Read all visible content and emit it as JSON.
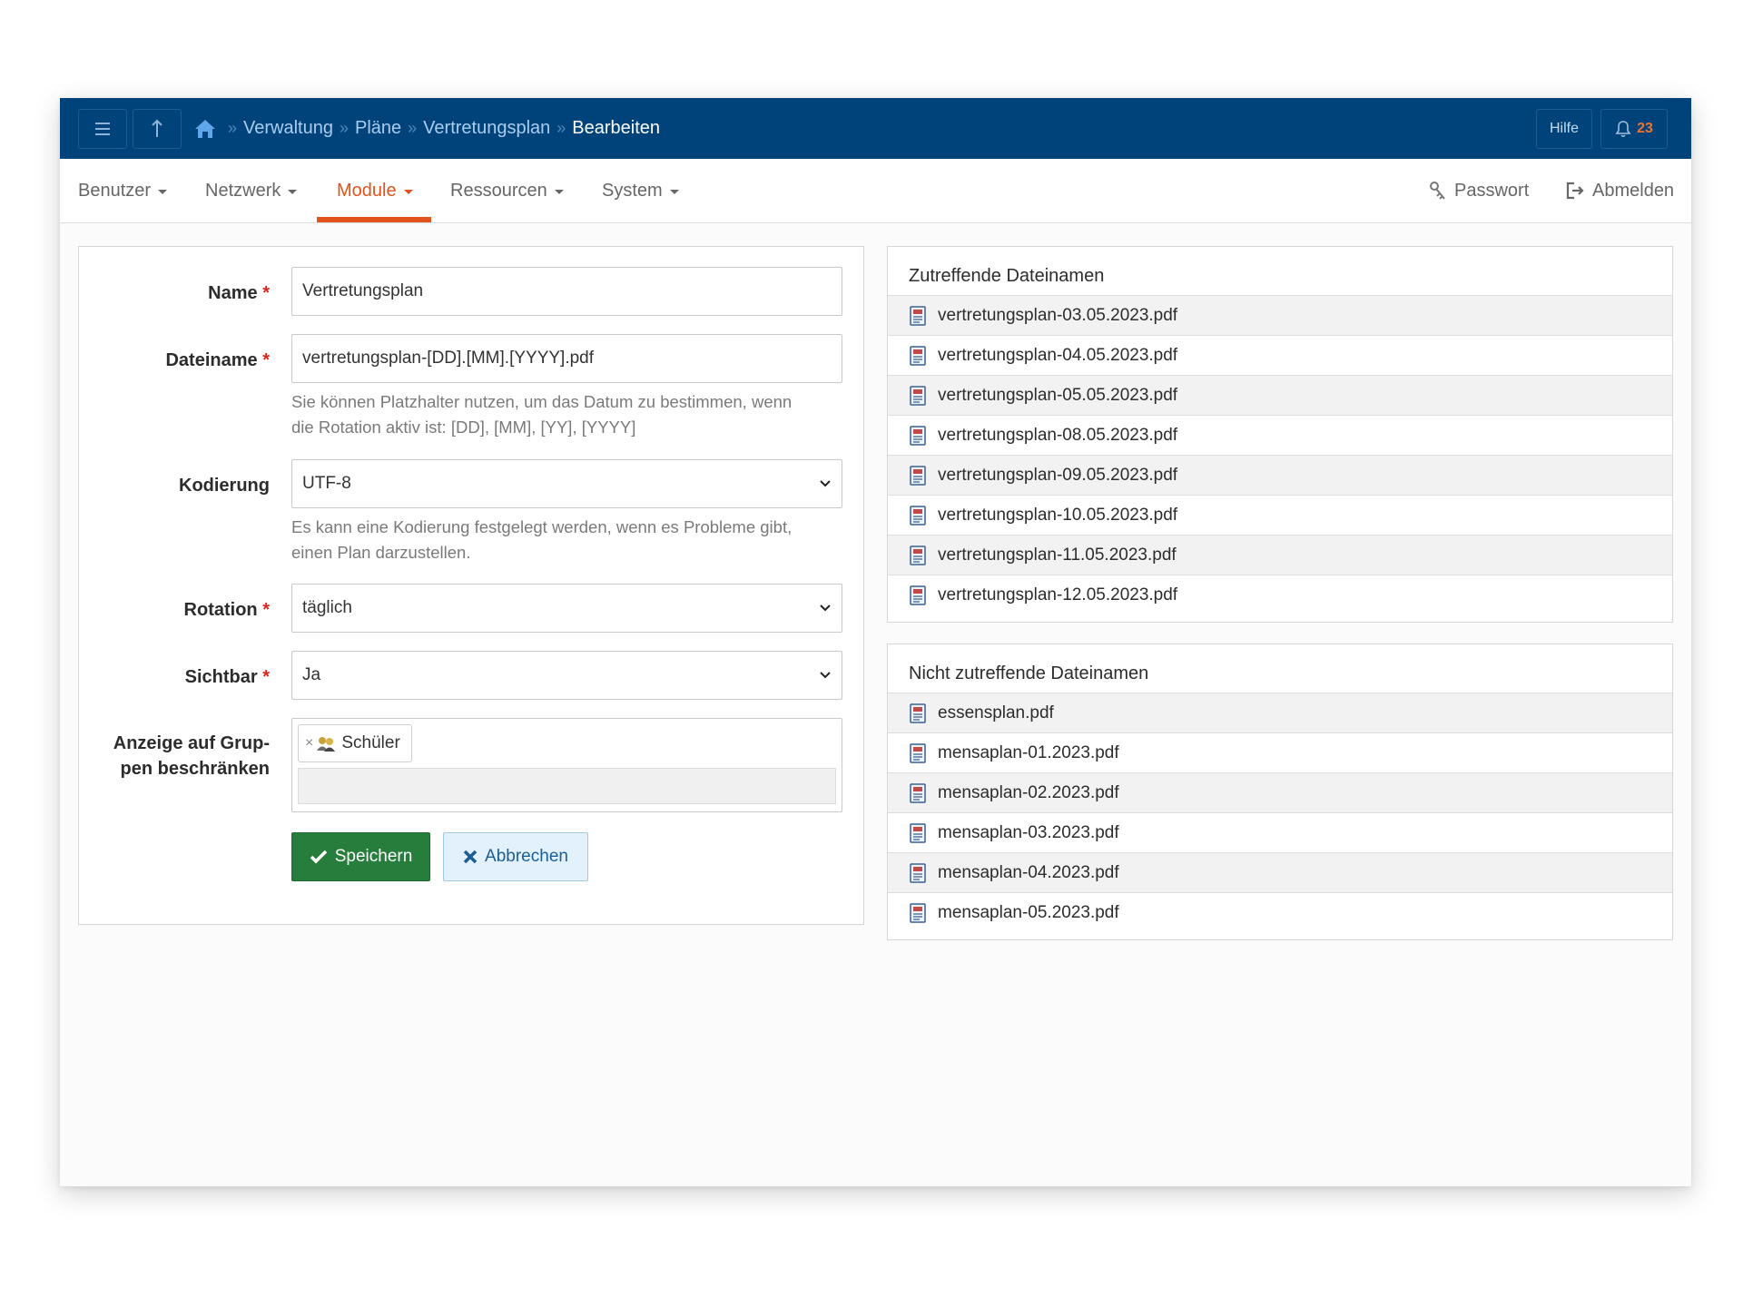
{
  "topbar": {
    "menu_icon": "hamburger-icon",
    "up_icon": "arrow-up-icon",
    "breadcrumb": {
      "home_icon": "home-icon",
      "separator": "»",
      "items": [
        "Verwaltung",
        "Pläne",
        "Vertretungsplan"
      ],
      "current": "Bearbeiten"
    },
    "help_label": "Hilfe",
    "notification_count": "23",
    "notification_icon": "bell-icon"
  },
  "nav": {
    "items": [
      {
        "label": "Benutzer"
      },
      {
        "label": "Netzwerk"
      },
      {
        "label": "Module",
        "active": true
      },
      {
        "label": "Ressourcen"
      },
      {
        "label": "System"
      }
    ],
    "password_label": "Passwort",
    "logout_label": "Abmelden"
  },
  "form": {
    "required_mark": "*",
    "name": {
      "label": "Name",
      "value": "Vertretungsplan"
    },
    "filename": {
      "label": "Dateiname",
      "value": "vertretungsplan-[DD].[MM].[YYYY].pdf",
      "help_line1": "Sie können Platzhalter nutzen, um das Datum zu bestimmen, wenn",
      "help_line2": "die Rotation aktiv ist: [DD], [MM], [YY], [YYYY]"
    },
    "encoding": {
      "label": "Kodierung",
      "value": "UTF-8",
      "help_line1": "Es kann eine Kodierung festgelegt werden, wenn es Probleme gibt,",
      "help_line2": "einen Plan darzustellen."
    },
    "rotation": {
      "label": "Rotation",
      "value": "täglich"
    },
    "visible": {
      "label": "Sichtbar",
      "value": "Ja"
    },
    "groups": {
      "label_line1": "Anzeige auf Grup-",
      "label_line2": "pen beschränken",
      "tags": [
        {
          "label": "Schüler",
          "remove": "×",
          "icon": "group-icon"
        }
      ]
    },
    "save_label": "Speichern",
    "cancel_label": "Abbrechen"
  },
  "matching": {
    "title": "Zutreffende Dateinamen",
    "files": [
      "vertretungsplan-03.05.2023.pdf",
      "vertretungsplan-04.05.2023.pdf",
      "vertretungsplan-05.05.2023.pdf",
      "vertretungsplan-08.05.2023.pdf",
      "vertretungsplan-09.05.2023.pdf",
      "vertretungsplan-10.05.2023.pdf",
      "vertretungsplan-11.05.2023.pdf",
      "vertretungsplan-12.05.2023.pdf"
    ]
  },
  "nonmatching": {
    "title": "Nicht zutreffende Dateinamen",
    "files": [
      "essensplan.pdf",
      "mensaplan-01.2023.pdf",
      "mensaplan-02.2023.pdf",
      "mensaplan-03.2023.pdf",
      "mensaplan-04.2023.pdf",
      "mensaplan-05.2023.pdf"
    ]
  },
  "colors": {
    "topbar": "#00437a",
    "accent": "#e0531c",
    "save": "#277d3b",
    "cancel_bg": "#e2f1fb"
  }
}
